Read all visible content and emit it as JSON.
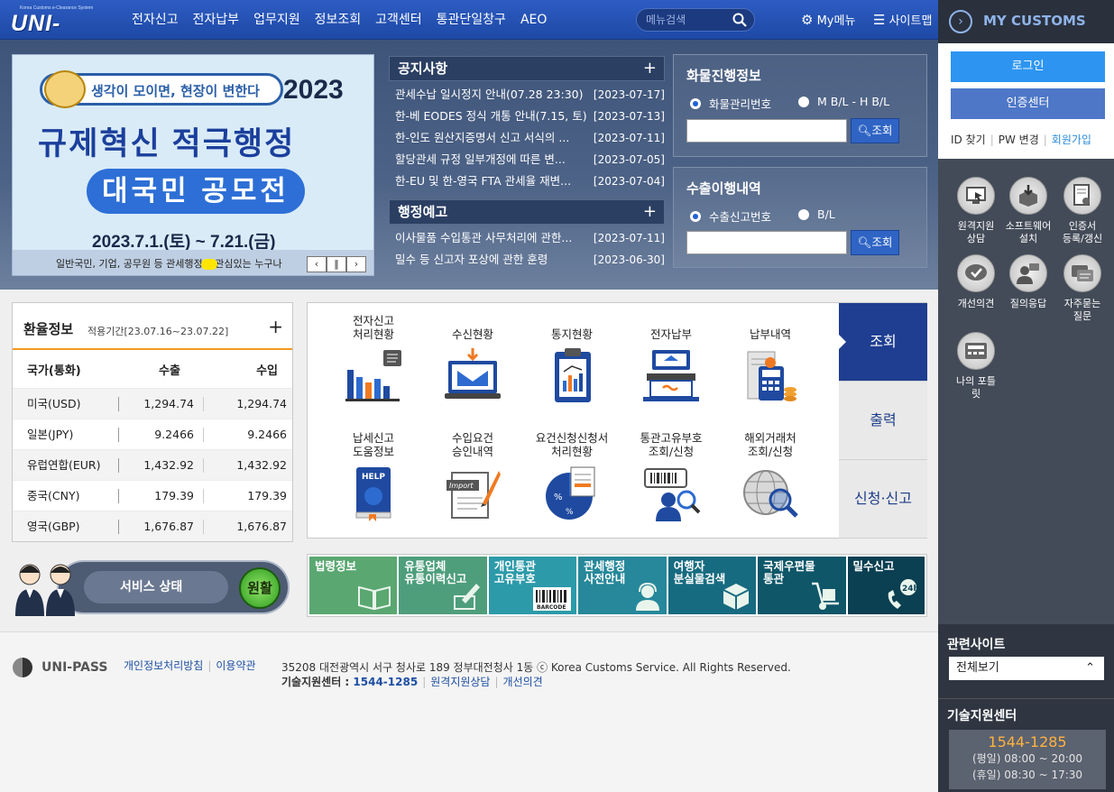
{
  "header": {
    "logo_small": "Korea Customs e-Clearance System",
    "logo": "UNI-PASS",
    "menu": [
      "전자신고",
      "전자납부",
      "업무지원",
      "정보조회",
      "고객센터",
      "통관단일창구",
      "AEO"
    ],
    "search_placeholder": "메뉴검색",
    "mymenu": "My메뉴",
    "sitemap": "사이트맵"
  },
  "banner": {
    "headline": "생각이 모이면, 현장이 변한다",
    "year": "2023",
    "title1": "규제혁신 적극행정",
    "title2": "대국민 공모전",
    "date": "2023.7.1.(토) ~ 7.21.(금)",
    "bottom": "일반국민, 기업, 공무원 등 관세행정에 관심있는 누구나"
  },
  "notice": {
    "title": "공지사항",
    "items": [
      {
        "text": "관세수납 일시정지 안내(07.28 23:30)",
        "date": "[2023-07-17]"
      },
      {
        "text": "한-베 EODES 정식 개통 안내(7.15, 토)",
        "date": "[2023-07-13]"
      },
      {
        "text": "한-인도 원산지증명서 신고 서식의 ...",
        "date": "[2023-07-11]"
      },
      {
        "text": "할당관세 규정 일부개정에 따른 변...",
        "date": "[2023-07-05]"
      },
      {
        "text": "한-EU 및 한-영국 FTA 관세율 재변...",
        "date": "[2023-07-04]"
      }
    ]
  },
  "admin": {
    "title": "행정예고",
    "items": [
      {
        "text": "이사물품 수입통관 사무처리에 관한...",
        "date": "[2023-07-11]"
      },
      {
        "text": "밀수 등 신고자 포상에 관한 훈령",
        "date": "[2023-06-30]"
      }
    ]
  },
  "cargo": {
    "title": "화물진행정보",
    "opt1": "화물관리번호",
    "opt2": "M B/L - H B/L",
    "button": "조회"
  },
  "export": {
    "title": "수출이행내역",
    "opt1": "수출신고번호",
    "opt2": "B/L",
    "button": "조회"
  },
  "exchange": {
    "title": "환율정보",
    "period": "적용기간[23.07.16~23.07.22]",
    "headers": [
      "국가(통화)",
      "수출",
      "수입"
    ],
    "rows": [
      {
        "country": "미국(USD)",
        "export": "1,294.74",
        "import": "1,294.74"
      },
      {
        "country": "일본(JPY)",
        "export": "9.2466",
        "import": "9.2466"
      },
      {
        "country": "유럽연합(EUR)",
        "export": "1,432.92",
        "import": "1,432.92"
      },
      {
        "country": "중국(CNY)",
        "export": "179.39",
        "import": "179.39"
      },
      {
        "country": "영국(GBP)",
        "export": "1,676.87",
        "import": "1,676.87"
      }
    ]
  },
  "services": {
    "items": [
      {
        "label": "전자신고\n처리현황"
      },
      {
        "label": "수신현황"
      },
      {
        "label": "통지현황"
      },
      {
        "label": "전자납부"
      },
      {
        "label": "납부내역"
      },
      {
        "label": "납세신고\n도움정보"
      },
      {
        "label": "수입요건\n승인내역"
      },
      {
        "label": "요건신청신청서\n처리현황"
      },
      {
        "label": "통관고유부호\n조회/신청"
      },
      {
        "label": "해외거래처\n조회/신청"
      }
    ],
    "tabs": [
      "조회",
      "출력",
      "신청·신고"
    ]
  },
  "status": {
    "label": "서비스 상태",
    "value": "원활"
  },
  "tiles": [
    {
      "label": "법령정보",
      "color": "#5aa771"
    },
    {
      "label": "유통업체\n유통이력신고",
      "color": "#4e9e7c"
    },
    {
      "label": "개인통관\n고유부호",
      "color": "#2c9aa9"
    },
    {
      "label": "관세행정\n사전안내",
      "color": "#26889a"
    },
    {
      "label": "여행자\n분실물검색",
      "color": "#176b80"
    },
    {
      "label": "국제우편물\n통관",
      "color": "#0f5669"
    },
    {
      "label": "밀수신고",
      "color": "#0b3f52"
    }
  ],
  "footer": {
    "logo": "UNI-PASS",
    "privacy": "개인정보처리방침",
    "terms": "이용약관",
    "address": "35208 대전광역시 서구 청사로 189 정부대전청사 1동 ⓒ Korea Customs Service. All Rights Reserved.",
    "tech_label": "기술지원센터 : ",
    "tech_number": "1544-1285",
    "remote": "원격지원상담",
    "feedback": "개선의견"
  },
  "side": {
    "title": "MY CUSTOMS",
    "login": "로그인",
    "cert": "인증센터",
    "find_id": "ID 찾기",
    "pw_change": "PW 변경",
    "join": "회원가입",
    "icons": [
      {
        "label": "원격지원\n상담"
      },
      {
        "label": "소프트웨어\n설치"
      },
      {
        "label": "인증서\n등록/갱신"
      },
      {
        "label": "개선의견"
      },
      {
        "label": "질의응답"
      },
      {
        "label": "자주묻는\n질문"
      },
      {
        "label": "나의 포틀\n릿"
      }
    ],
    "related_title": "관련사이트",
    "related_select": "전체보기",
    "tech_title": "기술지원센터",
    "tech_number": "1544-1285",
    "hours_weekday": "(평일) 08:00 ~ 20:00",
    "hours_holiday": "(휴일) 08:30 ~ 17:30"
  }
}
